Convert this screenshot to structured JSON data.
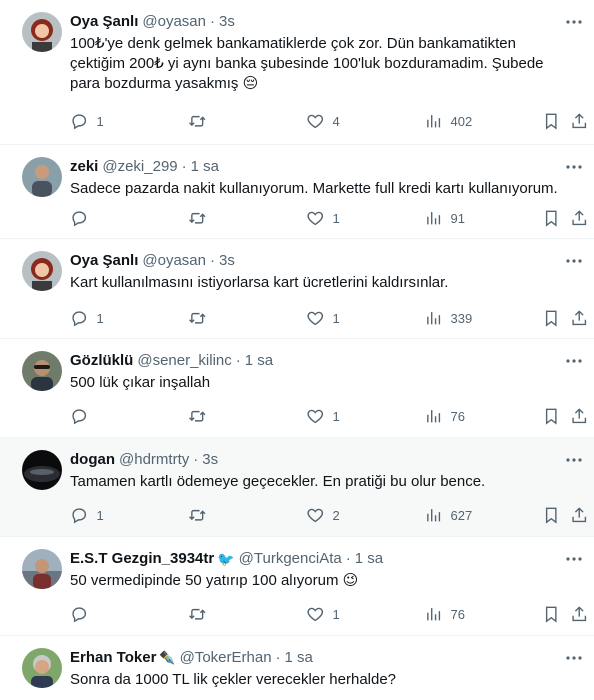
{
  "tweets": [
    {
      "name": "Oya Şanlı",
      "handle": "@oyasan",
      "sep": "·",
      "time": "3s",
      "text": "100₺'ye denk gelmek bankamatiklerde çok zor. Dün bankamatikten çektiğim 200₺ yi aynı banka şubesinde 100'luk bozduramadim. Şubede para bozdurma yasakmış 😔",
      "replies": "1",
      "retweets": "",
      "likes": "4",
      "views": "402",
      "avatar": "woman-red-hair"
    },
    {
      "name": "zeki",
      "handle": "@zeki_299",
      "sep": "·",
      "time": "1 sa",
      "text": "Sadece pazarda nakit kullanıyorum. Markette full kredi kartı kullanıyorum.",
      "replies": "",
      "retweets": "",
      "likes": "1",
      "views": "91",
      "avatar": "man-outdoor"
    },
    {
      "name": "Oya Şanlı",
      "handle": "@oyasan",
      "sep": "·",
      "time": "3s",
      "text": "Kart kullanılmasını istiyorlarsa kart ücretlerini kaldırsınlar.",
      "replies": "1",
      "retweets": "",
      "likes": "1",
      "views": "339",
      "avatar": "woman-red-hair"
    },
    {
      "name": "Gözlüklü",
      "handle": "@sener_kilinc",
      "sep": "·",
      "time": "1 sa",
      "text": "500 lük çıkar inşallah",
      "replies": "",
      "retweets": "",
      "likes": "1",
      "views": "76",
      "avatar": "man-sunglasses"
    },
    {
      "name": "dogan",
      "handle": "@hdrmtrty",
      "sep": "·",
      "time": "3s",
      "text": "Tamamen kartlı ödemeye geçecekler. En pratiği bu olur bence.",
      "replies": "1",
      "retweets": "",
      "likes": "2",
      "views": "627",
      "avatar": "dark-planet"
    },
    {
      "name": "E.S.T Gezgin_3934tr",
      "handle": "@TurkgenciAta",
      "sep": "·",
      "time": "1 sa",
      "text": "50 vermedipinde  50 yatırıp  100 alıyorum 😉",
      "replies": "",
      "retweets": "",
      "likes": "1",
      "views": "76",
      "avatar": "man-car",
      "name_emoji": "🐦"
    },
    {
      "name": "Erhan Toker",
      "handle": "@TokerErhan",
      "sep": "·",
      "time": "1 sa",
      "text": "Sonra da 1000 TL lik çekler verecekler herhalde?",
      "replies": "",
      "retweets": "",
      "likes": "",
      "views": "",
      "avatar": "man-gray-hair",
      "name_emoji": "✒️"
    }
  ],
  "colors": {
    "text": "#0f1419",
    "secondary": "#536471",
    "divider": "#eff3f4",
    "hover_bg": "#f7f9f9"
  }
}
